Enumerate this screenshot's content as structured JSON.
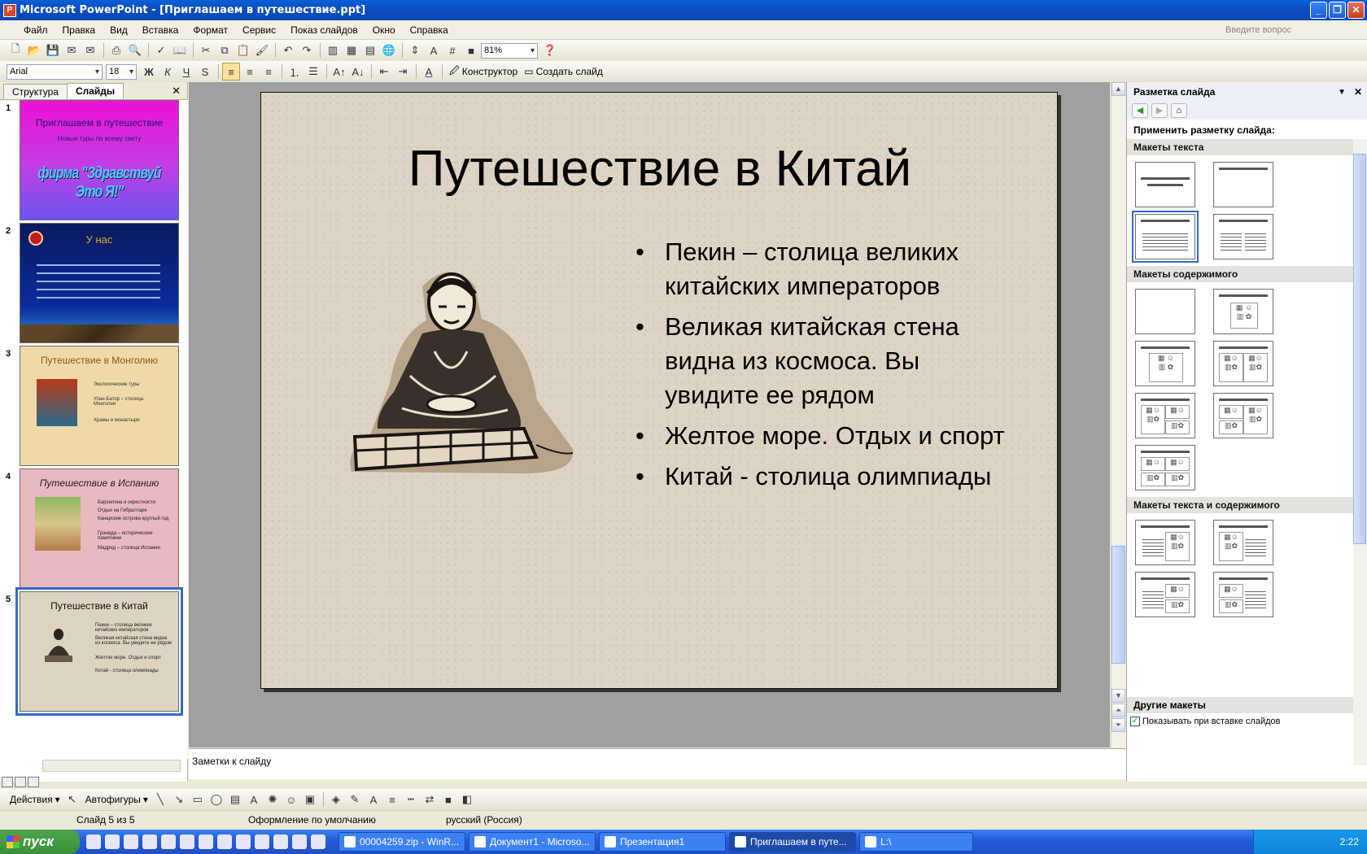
{
  "window": {
    "title": "Microsoft PowerPoint - [Приглашаем в путешествие.ppt]"
  },
  "menu": {
    "items": [
      "Файл",
      "Правка",
      "Вид",
      "Вставка",
      "Формат",
      "Сервис",
      "Показ слайдов",
      "Окно",
      "Справка"
    ],
    "ask_placeholder": "Введите вопрос"
  },
  "toolbar": {
    "zoom": "81%",
    "font": "Arial",
    "font_size": "18",
    "designer": "Конструктор",
    "new_slide": "Создать слайд"
  },
  "left_pane": {
    "tabs": [
      "Структура",
      "Слайды"
    ],
    "thumbs": [
      {
        "num": "1",
        "title": "Приглашаем в путешествие",
        "subtitle": "Новые туры по всему свету",
        "logo": "фирма \"Здравствуй Это Я!\""
      },
      {
        "num": "2",
        "title": "У нас"
      },
      {
        "num": "3",
        "title": "Путешествие в Монголию",
        "bullets": [
          "Экологические туры",
          "Улан-Батор – столица Монголии",
          "Храмы и монастыри"
        ]
      },
      {
        "num": "4",
        "title": "Путешествие в Испанию",
        "bullets": [
          "Барселона и окрестности",
          "Отдых на Гибралтаре",
          "Канарские острова круглый год",
          "Гранада – исторические памятники",
          "Мадрид – столица Испании"
        ]
      },
      {
        "num": "5",
        "title": "Путешествие в Китай",
        "bullets": [
          "Пекин – столица великих китайских императоров",
          "Великая китайская стена видна из космоса. Вы увидите ее рядом",
          "Желтое море. Отдых и спорт",
          "Китай - столица олимпиады"
        ]
      }
    ]
  },
  "slide": {
    "title": "Путешествие в Китай",
    "bullets": [
      "Пекин – столица великих китайских императоров",
      "Великая китайская стена видна из космоса. Вы увидите ее рядом",
      "Желтое море. Отдых и спорт",
      "Китай - столица олимпиады"
    ]
  },
  "notes": {
    "placeholder": "Заметки к слайду"
  },
  "task_pane": {
    "title": "Разметка слайда",
    "apply_label": "Применить разметку слайда:",
    "sections": [
      "Макеты текста",
      "Макеты содержимого",
      "Макеты текста и содержимого"
    ],
    "other_label": "Другие макеты",
    "show_on_insert": "Показывать при вставке слайдов"
  },
  "drawing_toolbar": {
    "actions": "Действия",
    "autoshapes": "Автофигуры"
  },
  "status": {
    "slide": "Слайд 5 из 5",
    "design": "Оформление по умолчанию",
    "language": "русский (Россия)"
  },
  "taskbar": {
    "start": "пуск",
    "tasks": [
      "00004259.zip - WinR...",
      "Документ1 - Microso...",
      "Презентация1",
      "Приглашаем в путе...",
      "L:\\"
    ],
    "clock": "2:22"
  }
}
